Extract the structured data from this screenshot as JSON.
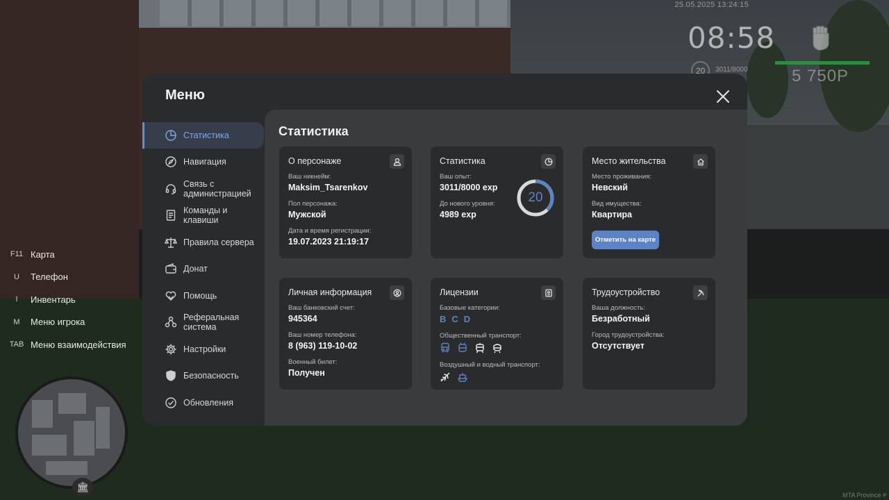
{
  "hud": {
    "datetime": "25.05.2025 13:24:15",
    "clock": "08:58",
    "level": "20",
    "exp": "3011/8000",
    "money": "5 750Р",
    "watermark": "MTA Province #"
  },
  "hotkeys": [
    {
      "key": "F11",
      "label": "Карта"
    },
    {
      "key": "U",
      "label": "Телефон"
    },
    {
      "key": "I",
      "label": "Инвентарь"
    },
    {
      "key": "M",
      "label": "Меню игрока"
    },
    {
      "key": "TAB",
      "label": "Меню взаимодействия"
    }
  ],
  "menu": {
    "title": "Меню",
    "sidebar": [
      {
        "label": "Статистика",
        "icon": "pie-chart-icon",
        "active": true
      },
      {
        "label": "Навигация",
        "icon": "compass-icon"
      },
      {
        "label": "Связь с\nадминистрацией",
        "icon": "headset-icon"
      },
      {
        "label": "Команды и\nклавиши",
        "icon": "document-icon"
      },
      {
        "label": "Правила сервера",
        "icon": "scales-icon"
      },
      {
        "label": "Донат",
        "icon": "wallet-icon"
      },
      {
        "label": "Помощь",
        "icon": "heart-hands-icon"
      },
      {
        "label": "Реферальная\nсистема",
        "icon": "network-icon"
      },
      {
        "label": "Настройки",
        "icon": "gear-icon"
      },
      {
        "label": "Безопасность",
        "icon": "shield-icon"
      },
      {
        "label": "Обновления",
        "icon": "check-badge-icon"
      }
    ]
  },
  "content": {
    "title": "Статистика",
    "character": {
      "title": "О персонаже",
      "icon": "user-icon",
      "nickname_label": "Ваш никнейм:",
      "nickname": "Maksim_Tsarenkov",
      "gender_label": "Пол персонажа:",
      "gender": "Мужской",
      "reg_label": "Дата и время регистрации:",
      "reg": "19.07.2023 21:19:17"
    },
    "stats": {
      "title": "Статистика",
      "icon": "clock-pie-icon",
      "exp_label": "Ваш опыт:",
      "exp": "3011/8000 exp",
      "next_label": "До нового уровня:",
      "next": "4989 exp",
      "level": "20",
      "level_progress": 0.376
    },
    "residence": {
      "title": "Место жительства",
      "icon": "house-icon",
      "place_label": "Место проживания:",
      "place": "Невский",
      "property_label": "Вид имущества:",
      "property": "Квартира",
      "map_button": "Отметить на карте"
    },
    "personal": {
      "title": "Личная информация",
      "icon": "user-circle-icon",
      "bank_label": "Ваш банковский счет:",
      "bank": "945364",
      "phone_label": "Ваш номер телефона:",
      "phone": "8 (963) 119-10-02",
      "military_label": "Военный билет:",
      "military": "Получен"
    },
    "licenses": {
      "title": "Лицензии",
      "icon": "id-card-icon",
      "base_label": "Базовые категории:",
      "categories": [
        "B",
        "C",
        "D"
      ],
      "public_label": "Общественный транспорт:",
      "air_label": "Воздушный и водный транспорт:"
    },
    "employment": {
      "title": "Трудоустройство",
      "icon": "pickaxe-icon",
      "position_label": "Ваша должность:",
      "position": "Безработный",
      "city_label": "Город трудоустройства:",
      "city": "Отсутствует"
    }
  }
}
